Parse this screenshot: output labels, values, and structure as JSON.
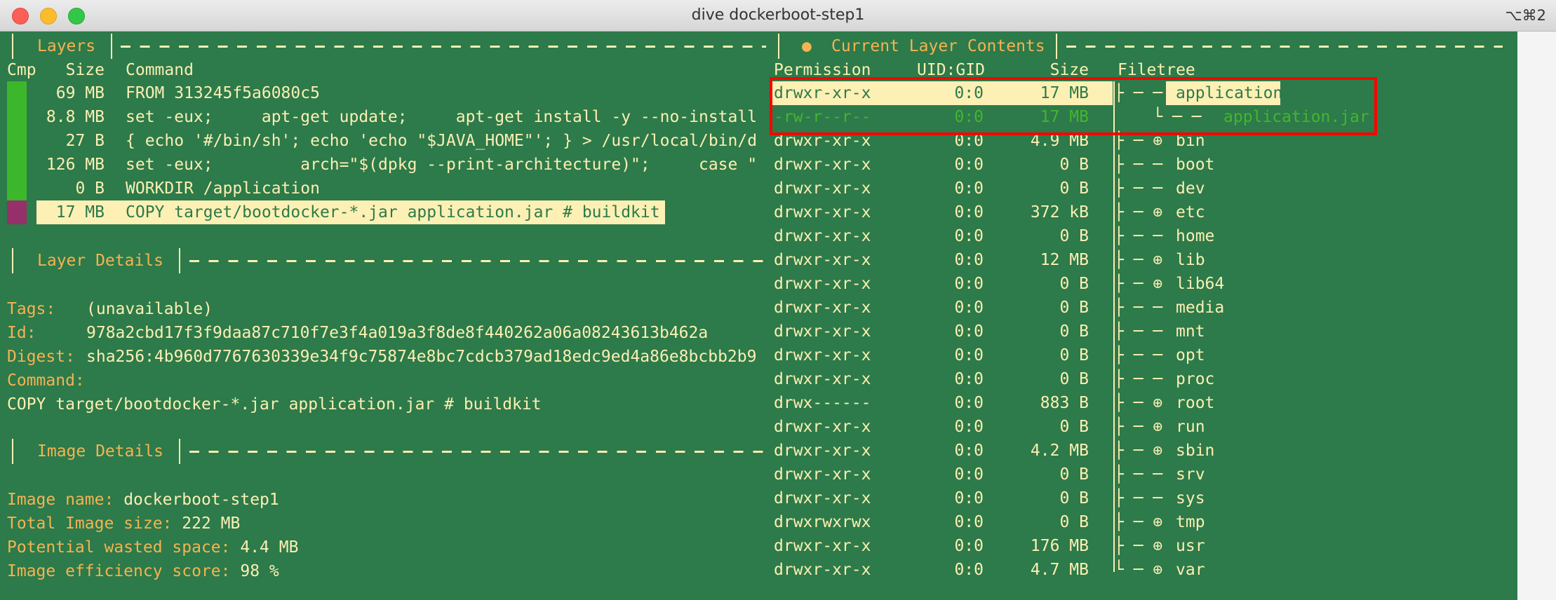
{
  "window": {
    "title": "dive dockerboot-step1",
    "shortcut": "⌥⌘2"
  },
  "colors": {
    "background": "#2d7a4a",
    "text": "#fbefb3",
    "label": "#f5b352",
    "cmp_unchanged": "#3cb62a",
    "cmp_modified": "#96306a",
    "selection_box": "#ff0000"
  },
  "layers": {
    "title": "Layers",
    "columns": {
      "cmp": "Cmp",
      "size": "Size",
      "command": "Command"
    },
    "rows": [
      {
        "size": "69 MB",
        "command": "FROM 313245f5a6080c5",
        "cmp": "unchanged"
      },
      {
        "size": "8.8 MB",
        "command": "set -eux;     apt-get update;     apt-get install -y --no-install",
        "cmp": "unchanged"
      },
      {
        "size": "27 B",
        "command": "{ echo '#/bin/sh'; echo 'echo \"$JAVA_HOME\"'; } > /usr/local/bin/d",
        "cmp": "unchanged"
      },
      {
        "size": "126 MB",
        "command": "set -eux;         arch=\"$(dpkg --print-architecture)\";     case \"",
        "cmp": "unchanged"
      },
      {
        "size": "0 B",
        "command": "WORKDIR /application",
        "cmp": "unchanged"
      },
      {
        "size": "17 MB",
        "command": "COPY target/bootdocker-*.jar application.jar # buildkit",
        "cmp": "modified",
        "selected": true
      }
    ]
  },
  "layer_details": {
    "title": "Layer Details",
    "tags_label": "Tags:",
    "tags": "(unavailable)",
    "id_label": "Id:",
    "id": "978a2cbd17f3f9daa87c710f7e3f4a019a3f8de8f440262a06a08243613b462a",
    "digest_label": "Digest:",
    "digest": "sha256:4b960d7767630339e34f9c75874e8bc7cdcb379ad18edc9ed4a86e8bcbb2b9",
    "command_label": "Command:",
    "command": "COPY target/bootdocker-*.jar application.jar # buildkit"
  },
  "image_details": {
    "title": "Image Details",
    "name_label": "Image name:",
    "name": "dockerboot-step1",
    "size_label": "Total Image size:",
    "size": "222 MB",
    "wasted_label": "Potential wasted space:",
    "wasted": "4.4 MB",
    "efficiency_label": "Image efficiency score:",
    "efficiency": "98 %"
  },
  "contents": {
    "title": "Current Layer Contents",
    "columns": {
      "permission": "Permission",
      "uidgid": "UID:GID",
      "size": "Size",
      "filetree": "Filetree"
    },
    "rows": [
      {
        "perm": "drwxr-xr-x",
        "uid": "0:0",
        "size": "17 MB",
        "tree": "├ ─ ─",
        "name": "application",
        "state": "selected"
      },
      {
        "perm": "-rw-r--r--",
        "uid": "0:0",
        "size": "17 MB",
        "tree": "    └ ─ ─",
        "name": "application.jar",
        "state": "added"
      },
      {
        "perm": "drwxr-xr-x",
        "uid": "0:0",
        "size": "4.9 MB",
        "tree": "├ ─ ⊕",
        "name": "bin"
      },
      {
        "perm": "drwxr-xr-x",
        "uid": "0:0",
        "size": "0 B",
        "tree": "├ ─ ─",
        "name": "boot"
      },
      {
        "perm": "drwxr-xr-x",
        "uid": "0:0",
        "size": "0 B",
        "tree": "├ ─ ─",
        "name": "dev"
      },
      {
        "perm": "drwxr-xr-x",
        "uid": "0:0",
        "size": "372 kB",
        "tree": "├ ─ ⊕",
        "name": "etc"
      },
      {
        "perm": "drwxr-xr-x",
        "uid": "0:0",
        "size": "0 B",
        "tree": "├ ─ ─",
        "name": "home"
      },
      {
        "perm": "drwxr-xr-x",
        "uid": "0:0",
        "size": "12 MB",
        "tree": "├ ─ ⊕",
        "name": "lib"
      },
      {
        "perm": "drwxr-xr-x",
        "uid": "0:0",
        "size": "0 B",
        "tree": "├ ─ ⊕",
        "name": "lib64"
      },
      {
        "perm": "drwxr-xr-x",
        "uid": "0:0",
        "size": "0 B",
        "tree": "├ ─ ─",
        "name": "media"
      },
      {
        "perm": "drwxr-xr-x",
        "uid": "0:0",
        "size": "0 B",
        "tree": "├ ─ ─",
        "name": "mnt"
      },
      {
        "perm": "drwxr-xr-x",
        "uid": "0:0",
        "size": "0 B",
        "tree": "├ ─ ─",
        "name": "opt"
      },
      {
        "perm": "drwxr-xr-x",
        "uid": "0:0",
        "size": "0 B",
        "tree": "├ ─ ─",
        "name": "proc"
      },
      {
        "perm": "drwx------",
        "uid": "0:0",
        "size": "883 B",
        "tree": "├ ─ ⊕",
        "name": "root"
      },
      {
        "perm": "drwxr-xr-x",
        "uid": "0:0",
        "size": "0 B",
        "tree": "├ ─ ⊕",
        "name": "run"
      },
      {
        "perm": "drwxr-xr-x",
        "uid": "0:0",
        "size": "4.2 MB",
        "tree": "├ ─ ⊕",
        "name": "sbin"
      },
      {
        "perm": "drwxr-xr-x",
        "uid": "0:0",
        "size": "0 B",
        "tree": "├ ─ ─",
        "name": "srv"
      },
      {
        "perm": "drwxr-xr-x",
        "uid": "0:0",
        "size": "0 B",
        "tree": "├ ─ ─",
        "name": "sys"
      },
      {
        "perm": "drwxrwxrwx",
        "uid": "0:0",
        "size": "0 B",
        "tree": "├ ─ ⊕",
        "name": "tmp"
      },
      {
        "perm": "drwxr-xr-x",
        "uid": "0:0",
        "size": "176 MB",
        "tree": "├ ─ ⊕",
        "name": "usr"
      },
      {
        "perm": "drwxr-xr-x",
        "uid": "0:0",
        "size": "4.7 MB",
        "tree": "└ ─ ⊕",
        "name": "var"
      }
    ]
  }
}
